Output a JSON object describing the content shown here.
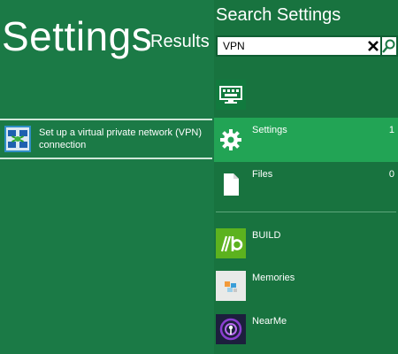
{
  "results": {
    "title": "Settings",
    "subtitle": "Results f",
    "item": {
      "label": "Set up a virtual private network (VPN) connection"
    }
  },
  "pane": {
    "title": "Search Settings",
    "search": {
      "value": "VPN",
      "placeholder": ""
    },
    "scopes": [
      {
        "label": "Settings",
        "count": "1",
        "icon": "gear-icon",
        "selected": true
      },
      {
        "label": "Files",
        "count": "0",
        "icon": "file-icon",
        "selected": false
      }
    ],
    "apps": [
      {
        "label": "BUILD",
        "icon": "build-app-icon",
        "color": "#5cb21e"
      },
      {
        "label": "Memories",
        "icon": "memories-app-icon",
        "color": "#e9eae8"
      },
      {
        "label": "NearMe",
        "icon": "nearme-app-icon",
        "color": "#1c1f3d"
      }
    ],
    "top_app_icon": "keyboard-icon"
  },
  "colors": {
    "background": "#1b7a46",
    "pane": "#18733f",
    "selected": "#22a455"
  }
}
